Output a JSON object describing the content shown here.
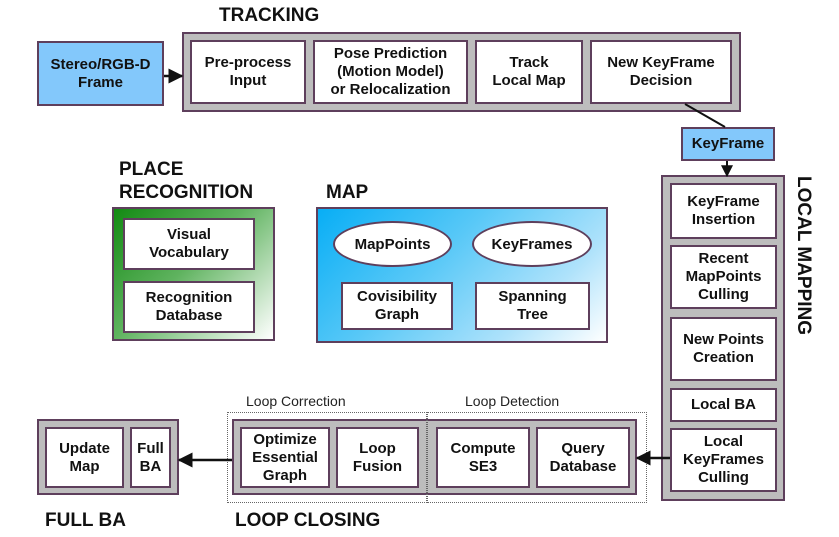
{
  "sections": {
    "tracking": "TRACKING",
    "place_recognition_line1": "PLACE",
    "place_recognition_line2": "RECOGNITION",
    "map": "MAP",
    "local_mapping": "LOCAL MAPPING",
    "full_ba": "FULL BA",
    "loop_closing": "LOOP CLOSING"
  },
  "subsections": {
    "loop_correction": "Loop Correction",
    "loop_detection": "Loop Detection"
  },
  "input": {
    "line1": "Stereo/RGB-D",
    "line2": "Frame"
  },
  "tracking_steps": [
    {
      "line1": "Pre-process",
      "line2": "Input"
    },
    {
      "line1": "Pose Prediction",
      "line2": "(Motion Model)",
      "line3": "or Relocalization"
    },
    {
      "line1": "Track",
      "line2": "Local Map"
    },
    {
      "line1": "New KeyFrame",
      "line2": "Decision"
    }
  ],
  "keyframe": "KeyFrame",
  "place_recognition": [
    {
      "line1": "Visual",
      "line2": "Vocabulary"
    },
    {
      "line1": "Recognition",
      "line2": "Database"
    }
  ],
  "map_items": {
    "mappoints": "MapPoints",
    "keyframes": "KeyFrames",
    "covisibility": {
      "line1": "Covisibility",
      "line2": "Graph"
    },
    "spanning": {
      "line1": "Spanning",
      "line2": "Tree"
    }
  },
  "local_mapping_steps": [
    {
      "line1": "KeyFrame",
      "line2": "Insertion"
    },
    {
      "line1": "Recent",
      "line2": "MapPoints",
      "line3": "Culling"
    },
    {
      "line1": "New Points",
      "line2": "Creation"
    },
    {
      "line1": "Local BA"
    },
    {
      "line1": "Local",
      "line2": "KeyFrames",
      "line3": "Culling"
    }
  ],
  "loop_detection_steps": [
    {
      "line1": "Query",
      "line2": "Database"
    },
    {
      "line1": "Compute",
      "line2": "SE3"
    }
  ],
  "loop_correction_steps": [
    {
      "line1": "Loop",
      "line2": "Fusion"
    },
    {
      "line1": "Optimize",
      "line2": "Essential",
      "line3": "Graph"
    }
  ],
  "full_ba_steps": [
    {
      "line1": "Full",
      "line2": "BA"
    },
    {
      "line1": "Update",
      "line2": "Map"
    }
  ],
  "colors": {
    "input_blue": "#83c8fb",
    "group_gray": "#bdbdbd",
    "border_purple": "#5e3f5c",
    "place_green": "#138a13",
    "map_blue": "#08aef5"
  }
}
